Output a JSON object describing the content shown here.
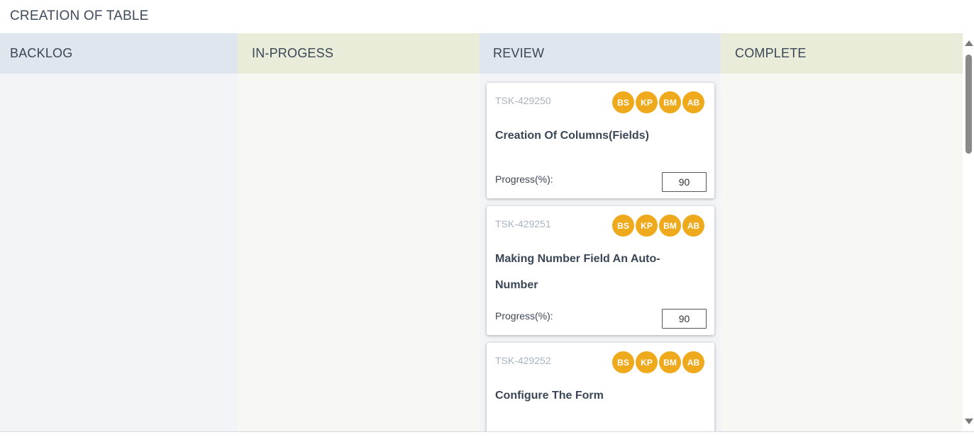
{
  "page": {
    "title": "CREATION OF TABLE"
  },
  "columns": [
    {
      "title": "BACKLOG"
    },
    {
      "title": "IN-PROGESS"
    },
    {
      "title": "REVIEW"
    },
    {
      "title": "COMPLETE"
    }
  ],
  "review_cards": [
    {
      "id": "TSK-429250",
      "title": "Creation Of Columns(Fields)",
      "progress_label": "Progress(%):",
      "progress_value": "90",
      "assignees": [
        "BS",
        "KP",
        "BM",
        "AB"
      ]
    },
    {
      "id": "TSK-429251",
      "title": "Making Number Field An Auto-Number",
      "progress_label": "Progress(%):",
      "progress_value": "90",
      "assignees": [
        "BS",
        "KP",
        "BM",
        "AB"
      ]
    },
    {
      "id": "TSK-429252",
      "title": "Configure The Form",
      "assignees": [
        "BS",
        "KP",
        "BM",
        "AB"
      ]
    }
  ],
  "colors": {
    "avatar": "#eeaa1c",
    "header_blue": "#dfe6ee",
    "header_olive": "#eaecda"
  }
}
